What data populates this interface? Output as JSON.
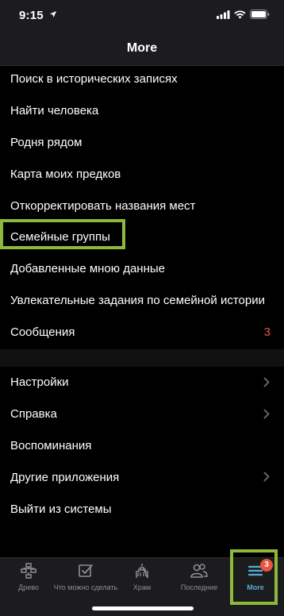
{
  "status_bar": {
    "time": "9:15"
  },
  "header": {
    "title": "More"
  },
  "menu_primary": [
    {
      "label": "Поиск в исторических записях"
    },
    {
      "label": "Найти человека"
    },
    {
      "label": "Родня рядом"
    },
    {
      "label": "Карта моих предков"
    },
    {
      "label": "Откорректировать названия мест"
    },
    {
      "label": "Семейные группы"
    },
    {
      "label": "Добавленные мною данные"
    },
    {
      "label": "Увлекательные задания по семейной истории"
    },
    {
      "label": "Сообщения",
      "count": "3"
    }
  ],
  "menu_secondary": [
    {
      "label": "Настройки",
      "has_chevron": true
    },
    {
      "label": "Справка",
      "has_chevron": true
    },
    {
      "label": "Воспоминания",
      "has_chevron": false
    },
    {
      "label": "Другие приложения",
      "has_chevron": true
    },
    {
      "label": "Выйти из системы",
      "has_chevron": false
    }
  ],
  "tab_bar": {
    "tabs": [
      {
        "label": "Древо",
        "icon": "tree-icon"
      },
      {
        "label": "Что можно сделать",
        "icon": "checklist-icon"
      },
      {
        "label": "Храм",
        "icon": "temple-icon"
      },
      {
        "label": "Последние",
        "icon": "people-icon"
      },
      {
        "label": "More",
        "icon": "menu-icon",
        "active": true,
        "badge": "3"
      }
    ]
  },
  "colors": {
    "accent": "#5aa9d6",
    "badge": "#e8563f",
    "highlight": "#8cb83e"
  }
}
